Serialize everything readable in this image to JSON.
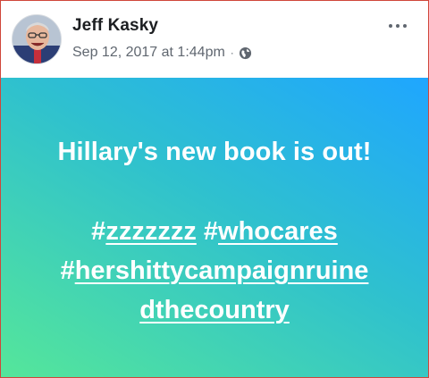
{
  "post": {
    "author": "Jeff Kasky",
    "timestamp": "Sep 12, 2017 at 1:44pm",
    "separator": "·",
    "privacy_icon": "globe-icon",
    "more_icon": "more-options-icon",
    "headline": "Hillary's new book is out!",
    "hashtags": [
      {
        "hash": "#",
        "word": "zzzzzzz"
      },
      {
        "hash": "#",
        "word": "whocares"
      },
      {
        "hash": "#",
        "word": "hershittycampaignruine"
      },
      {
        "cont": "dthecountry"
      }
    ]
  },
  "colors": {
    "gradient_top_right": "#1fa6ff",
    "gradient_mid": "#2fc1ce",
    "gradient_bottom_left": "#55e69a",
    "text_on_bg": "#ffffff"
  }
}
